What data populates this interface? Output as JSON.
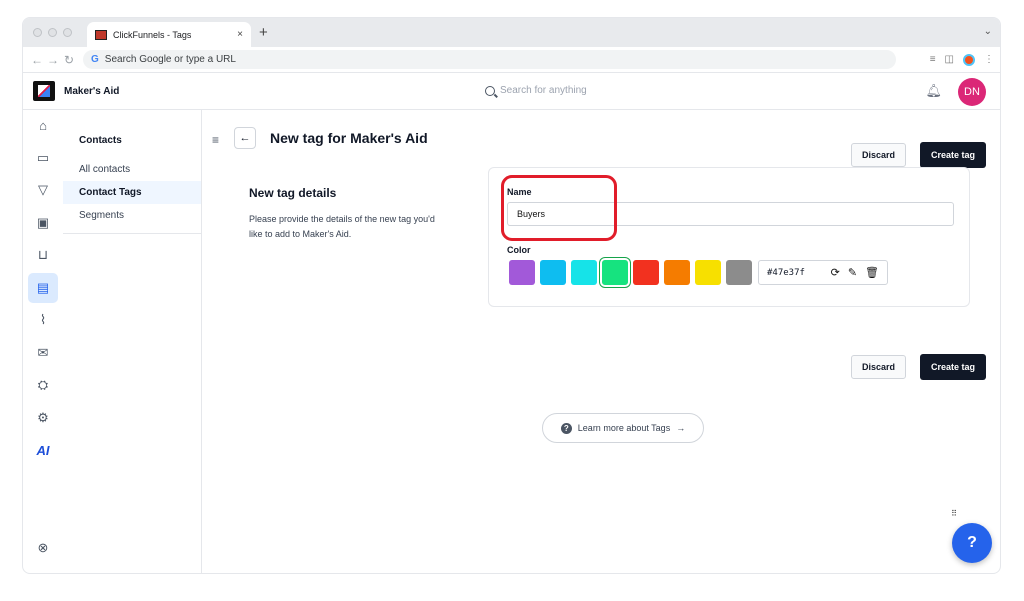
{
  "browser": {
    "tab_title": "ClickFunnels - Tags",
    "tab_close": "×",
    "new_tab": "+",
    "address_placeholder": "Search Google or type a URL",
    "address_prefix": "G"
  },
  "app": {
    "brand": "Maker's Aid",
    "search_placeholder": "Search for anything",
    "avatar_initials": "DN"
  },
  "rail": {
    "ai_label": "AI"
  },
  "subnav": {
    "heading": "Contacts",
    "items": [
      "All contacts",
      "Contact Tags",
      "Segments"
    ],
    "selected": "Contact Tags"
  },
  "page": {
    "title": "New tag for Maker's Aid",
    "discard_label": "Discard",
    "create_label": "Create tag",
    "section_title": "New tag details",
    "section_desc": "Please provide the details of the new tag you'd like to add to Maker's Aid.",
    "name_label": "Name",
    "name_value": "Buyers",
    "color_label": "Color",
    "swatches": [
      "#a259d9",
      "#0ebdf0",
      "#16e3e8",
      "#16e37f",
      "#f2311f",
      "#f57c00",
      "#f7e000",
      "#8c8c8c"
    ],
    "selected_color": "#47e37f",
    "learn_more": "Learn more about Tags"
  },
  "colors": {
    "primary_dark": "#111827",
    "highlight_red": "#e11d2a",
    "accent_blue": "#2563eb",
    "avatar_pink": "#db2777"
  }
}
